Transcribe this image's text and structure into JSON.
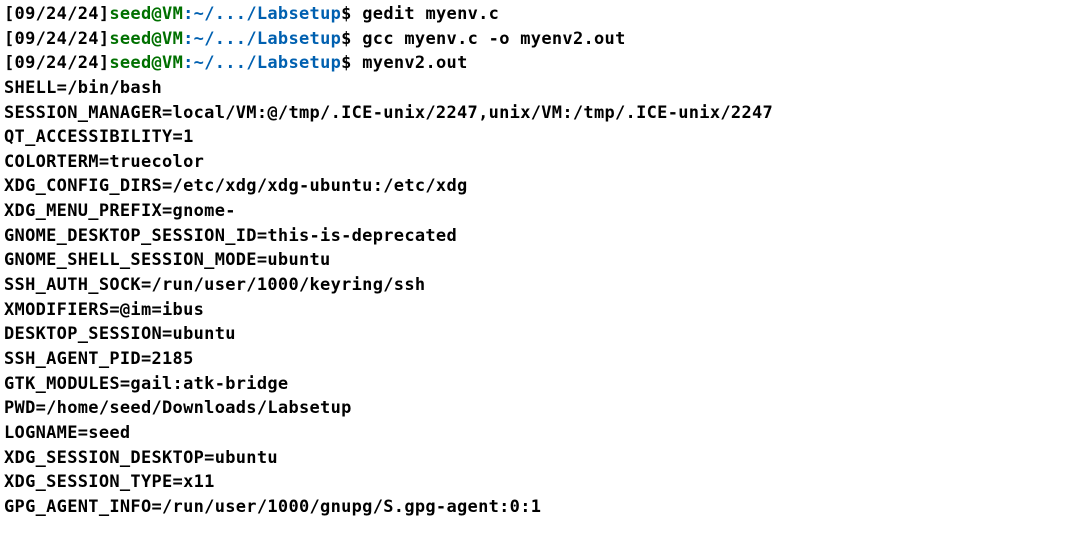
{
  "prompts": [
    {
      "date": "[09/24/24]",
      "userhost": "seed@VM",
      "colon": ":",
      "path": "~/.../Labsetup",
      "dollar": "$",
      "command": "gedit myenv.c"
    },
    {
      "date": "[09/24/24]",
      "userhost": "seed@VM",
      "colon": ":",
      "path": "~/.../Labsetup",
      "dollar": "$",
      "command": "gcc myenv.c -o myenv2.out"
    },
    {
      "date": "[09/24/24]",
      "userhost": "seed@VM",
      "colon": ":",
      "path": "~/.../Labsetup",
      "dollar": "$",
      "command": "myenv2.out"
    }
  ],
  "output_lines": [
    "SHELL=/bin/bash",
    "SESSION_MANAGER=local/VM:@/tmp/.ICE-unix/2247,unix/VM:/tmp/.ICE-unix/2247",
    "QT_ACCESSIBILITY=1",
    "COLORTERM=truecolor",
    "XDG_CONFIG_DIRS=/etc/xdg/xdg-ubuntu:/etc/xdg",
    "XDG_MENU_PREFIX=gnome-",
    "GNOME_DESKTOP_SESSION_ID=this-is-deprecated",
    "GNOME_SHELL_SESSION_MODE=ubuntu",
    "SSH_AUTH_SOCK=/run/user/1000/keyring/ssh",
    "XMODIFIERS=@im=ibus",
    "DESKTOP_SESSION=ubuntu",
    "SSH_AGENT_PID=2185",
    "GTK_MODULES=gail:atk-bridge",
    "PWD=/home/seed/Downloads/Labsetup",
    "LOGNAME=seed",
    "XDG_SESSION_DESKTOP=ubuntu",
    "XDG_SESSION_TYPE=x11",
    "GPG_AGENT_INFO=/run/user/1000/gnupg/S.gpg-agent:0:1"
  ]
}
